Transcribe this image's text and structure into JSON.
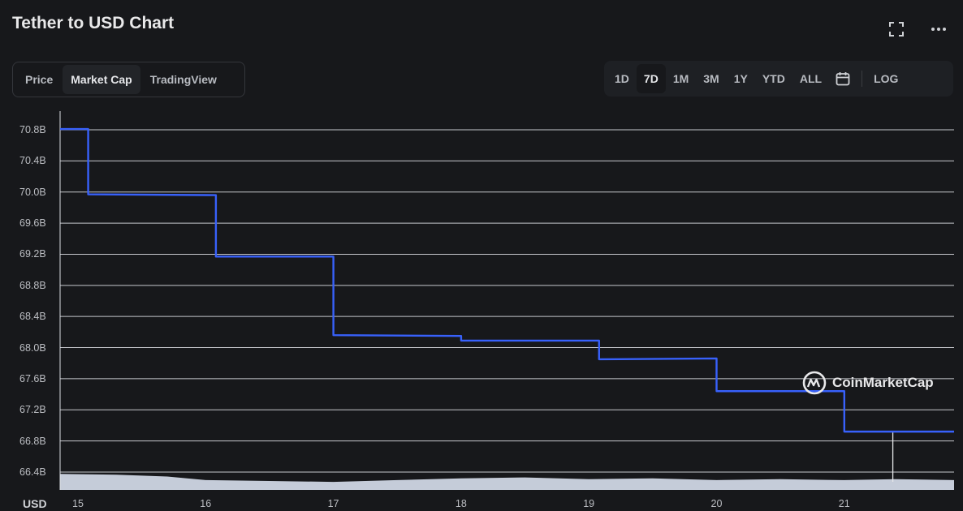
{
  "header": {
    "title": "Tether to USD Chart"
  },
  "icons": {
    "fullscreen": "fullscreen-icon",
    "more": "more-horizontal-icon",
    "calendar": "calendar-icon"
  },
  "tabs": [
    {
      "label": "Price",
      "active": false
    },
    {
      "label": "Market Cap",
      "active": true
    },
    {
      "label": "TradingView",
      "active": false
    }
  ],
  "ranges": [
    {
      "label": "1D",
      "active": false
    },
    {
      "label": "7D",
      "active": true
    },
    {
      "label": "1M",
      "active": false
    },
    {
      "label": "3M",
      "active": false
    },
    {
      "label": "1Y",
      "active": false
    },
    {
      "label": "YTD",
      "active": false
    },
    {
      "label": "ALL",
      "active": false
    }
  ],
  "log_label": "LOG",
  "currency_label": "USD",
  "watermark": "CoinMarketCap",
  "colors": {
    "line": "#3861fb",
    "grid": "#d9dbe0",
    "volume": "#cfd6e4",
    "background": "#17181b"
  },
  "chart_data": {
    "type": "line",
    "title": "Tether to USD Chart",
    "xlabel": "",
    "ylabel": "",
    "x_ticks": [
      "15",
      "16",
      "17",
      "18",
      "19",
      "20",
      "21"
    ],
    "y_ticks": [
      "70.8B",
      "70.4B",
      "70.0B",
      "69.6B",
      "69.2B",
      "68.8B",
      "68.4B",
      "68.0B",
      "67.6B",
      "67.2B",
      "66.8B",
      "66.4B"
    ],
    "ylim": [
      66.4,
      70.8
    ],
    "xlim": [
      14.85,
      21.86
    ],
    "grid": true,
    "series": [
      {
        "name": "",
        "unit": "B USD",
        "x": [
          14.85,
          15.08,
          15.08,
          16.08,
          16.08,
          17.0,
          17.0,
          18.0,
          18.0,
          19.08,
          19.08,
          20.0,
          20.0,
          21.0,
          21.0,
          21.86
        ],
        "y": [
          70.81,
          70.81,
          69.97,
          69.96,
          69.17,
          69.17,
          68.16,
          68.15,
          68.09,
          68.09,
          67.85,
          67.86,
          67.44,
          67.44,
          66.92,
          66.92
        ]
      }
    ],
    "volume": {
      "x": [
        14.85,
        15.3,
        15.7,
        16.0,
        16.5,
        17.0,
        17.5,
        18.0,
        18.5,
        19.0,
        19.5,
        20.0,
        20.5,
        21.0,
        21.4,
        21.86
      ],
      "relative": [
        0.9,
        0.85,
        0.75,
        0.55,
        0.5,
        0.45,
        0.55,
        0.65,
        0.7,
        0.6,
        0.65,
        0.55,
        0.6,
        0.55,
        0.6,
        0.55
      ]
    },
    "crosshair_x": 21.38
  }
}
